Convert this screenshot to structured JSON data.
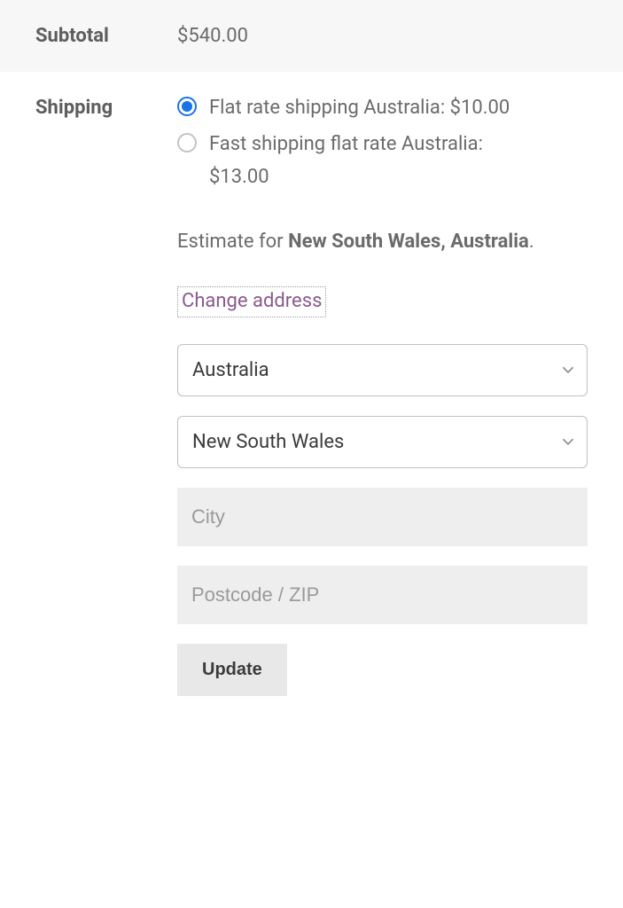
{
  "subtotal": {
    "label": "Subtotal",
    "value": "$540.00"
  },
  "shipping": {
    "label": "Shipping",
    "options": [
      {
        "label": "Flat rate shipping Australia:",
        "price": "$10.00",
        "selected": true
      },
      {
        "label": "Fast shipping flat rate Australia:",
        "price": "$13.00",
        "selected": false
      }
    ],
    "estimate_prefix": "Estimate for ",
    "estimate_location": "New South Wales, Australia",
    "estimate_suffix": ".",
    "change_address_label": "Change address",
    "country_select": "Australia",
    "state_select": "New South Wales",
    "city_placeholder": "City",
    "postcode_placeholder": "Postcode / ZIP",
    "update_button": "Update"
  }
}
